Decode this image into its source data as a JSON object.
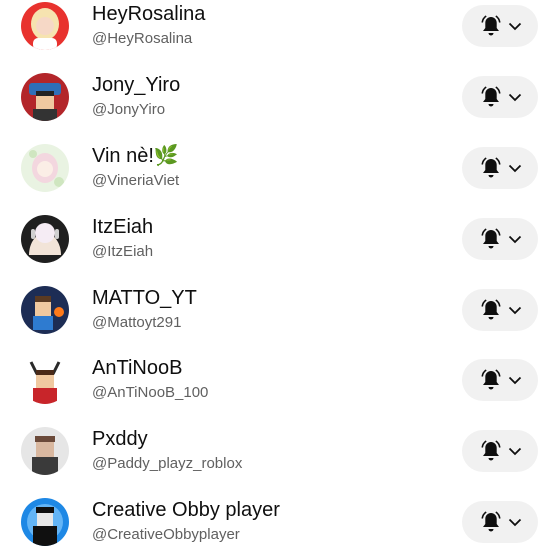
{
  "subscriptions": [
    {
      "name": "HeyRosalina",
      "handle": "@HeyRosalina",
      "avatar_colors": [
        "#e8322e",
        "#f6d8c6"
      ],
      "notify_icon": "bell-icon"
    },
    {
      "name": "Jony_Yiro",
      "handle": "@JonyYiro",
      "avatar_colors": [
        "#b3262a",
        "#2f6fb8"
      ],
      "notify_icon": "bell-icon"
    },
    {
      "name": "Vin nè!🌿",
      "handle": "@VineriaViet",
      "avatar_colors": [
        "#e9f3e2",
        "#f3d7df"
      ],
      "notify_icon": "bell-icon"
    },
    {
      "name": "ItzEiah",
      "handle": "@ItzEiah",
      "avatar_colors": [
        "#1f1f1f",
        "#f2e4d8"
      ],
      "notify_icon": "bell-icon"
    },
    {
      "name": "MATTO_YT",
      "handle": "@Mattoyt291",
      "avatar_colors": [
        "#1d2d55",
        "#f0c9a0"
      ],
      "notify_icon": "bell-icon"
    },
    {
      "name": "AnTiNooB",
      "handle": "@AnTiNooB_100",
      "avatar_colors": [
        "#ffffff",
        "#c8252a"
      ],
      "notify_icon": "bell-icon"
    },
    {
      "name": "Pxddy",
      "handle": "@Paddy_playz_roblox",
      "avatar_colors": [
        "#e6e6e6",
        "#6b4a3a"
      ],
      "notify_icon": "bell-icon"
    },
    {
      "name": "Creative Obby player",
      "handle": "@CreativeObbyplayer",
      "avatar_colors": [
        "#1e88e5",
        "#101010"
      ],
      "notify_icon": "bell-icon"
    }
  ]
}
